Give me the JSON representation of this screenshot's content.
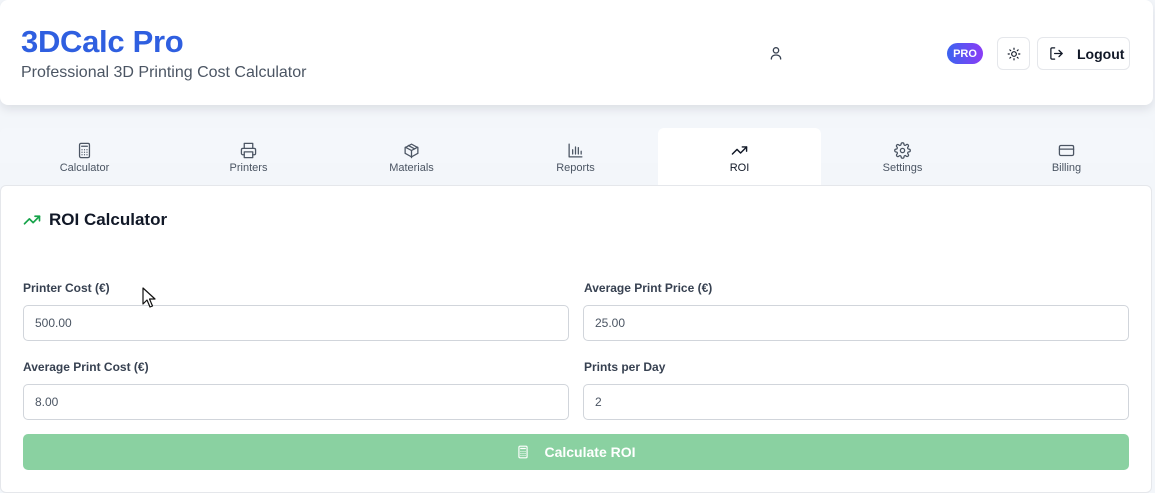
{
  "header": {
    "title": "3DCalc Pro",
    "subtitle": "Professional 3D Printing Cost Calculator",
    "badge": "PRO",
    "logout_label": "Logout"
  },
  "tabs": [
    {
      "label": "Calculator",
      "icon": "calculator-icon"
    },
    {
      "label": "Printers",
      "icon": "printer-icon"
    },
    {
      "label": "Materials",
      "icon": "box-icon"
    },
    {
      "label": "Reports",
      "icon": "bar-chart-icon"
    },
    {
      "label": "ROI",
      "icon": "trending-up-icon",
      "active": true
    },
    {
      "label": "Settings",
      "icon": "gear-icon"
    },
    {
      "label": "Billing",
      "icon": "credit-card-icon"
    }
  ],
  "roi": {
    "title": "ROI Calculator",
    "fields": {
      "printer_cost": {
        "label": "Printer Cost (€)",
        "value": "500.00"
      },
      "avg_print_price": {
        "label": "Average Print Price (€)",
        "value": "25.00"
      },
      "avg_print_cost": {
        "label": "Average Print Cost (€)",
        "value": "8.00"
      },
      "prints_per_day": {
        "label": "Prints per Day",
        "value": "2"
      }
    },
    "calculate_label": "Calculate ROI"
  },
  "colors": {
    "brand": "#2f5fe0",
    "accent_green": "#16a34a",
    "button_disabled_green": "#8ad1a1",
    "badge_gradient_start": "#3b63f0",
    "badge_gradient_end": "#8b3cf6"
  }
}
